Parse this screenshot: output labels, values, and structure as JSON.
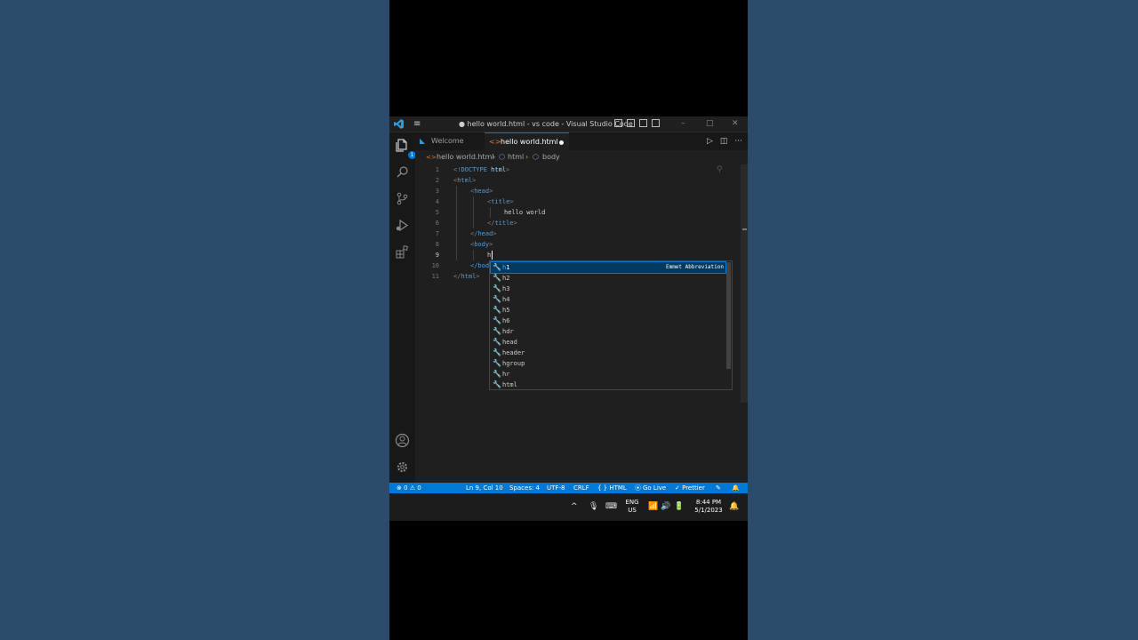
{
  "window": {
    "title": "● hello world.html - vs code - Visual Studio Code",
    "menu_glyph": "≡",
    "minimize": "–",
    "maximize": "□",
    "close": "✕"
  },
  "activity_bar": {
    "explorer_badge": "1",
    "items": [
      "files-icon",
      "search-icon",
      "source-control-icon",
      "run-debug-icon",
      "extensions-icon",
      "account-icon",
      "settings-gear-icon"
    ]
  },
  "tabs": [
    {
      "label": "Welcome",
      "active": false
    },
    {
      "label": "hello world.html",
      "active": true,
      "modified": true
    }
  ],
  "breadcrumb": {
    "file": "hello world.html",
    "sep": "›",
    "items": [
      "html",
      "body"
    ]
  },
  "editor": {
    "line_numbers": [
      "1",
      "2",
      "3",
      "4",
      "5",
      "6",
      "7",
      "8",
      "9",
      "10",
      "11"
    ],
    "current_line": "9",
    "lines": [
      {
        "open": "<!",
        "name": "DOCTYPE",
        "attr": "html",
        "close": ">"
      },
      {
        "open": "<",
        "name": "html",
        "close": ">"
      },
      {
        "open": "<",
        "name": "head",
        "close": ">"
      },
      {
        "open": "<",
        "name": "title",
        "close": ">"
      },
      {
        "text": "hello world"
      },
      {
        "open": "</",
        "name": "title",
        "close": ">"
      },
      {
        "open": "</",
        "name": "head",
        "close": ">"
      },
      {
        "open": "<",
        "name": "body",
        "close": ">"
      },
      {
        "text": "h"
      },
      {
        "open": "</",
        "name": "body",
        "close": ">"
      },
      {
        "open": "</",
        "name": "html",
        "close": ">"
      }
    ],
    "line10_partial": "</bod"
  },
  "suggestions": {
    "typed": "h",
    "detail": "Emmet Abbreviation",
    "items": [
      "h1",
      "h2",
      "h3",
      "h4",
      "h5",
      "h6",
      "hdr",
      "head",
      "header",
      "hgroup",
      "hr",
      "html"
    ]
  },
  "status_bar": {
    "problems": "⊗ 0 ⚠ 0",
    "position": "Ln 9, Col 10",
    "spaces": "Spaces: 4",
    "encoding": "UTF-8",
    "eol": "CRLF",
    "language": "{ } HTML",
    "go_live": "Go Live",
    "prettier": "✓ Prettier"
  },
  "taskbar": {
    "chevron": "^",
    "lang_line1": "ENG",
    "lang_line2": "US",
    "time": "8:44 PM",
    "date": "5/1/2023"
  },
  "colors": {
    "accent": "#0078d4",
    "tag": "#569cd6",
    "editor_bg": "#1f1f1f",
    "match": "#2aaaff"
  }
}
